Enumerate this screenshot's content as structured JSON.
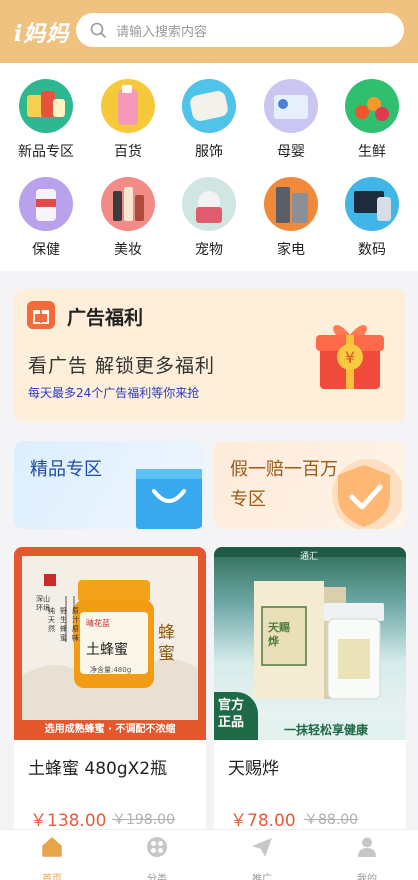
{
  "header": {
    "logo": "i妈妈",
    "search_placeholder": "请输入搜索内容"
  },
  "categories": [
    {
      "label": "新品专区",
      "icon": "new-products-icon"
    },
    {
      "label": "百货",
      "icon": "general-goods-icon"
    },
    {
      "label": "服饰",
      "icon": "clothing-icon"
    },
    {
      "label": "母婴",
      "icon": "mother-baby-icon"
    },
    {
      "label": "生鲜",
      "icon": "fresh-food-icon"
    },
    {
      "label": "保健",
      "icon": "health-icon"
    },
    {
      "label": "美妆",
      "icon": "beauty-icon"
    },
    {
      "label": "宠物",
      "icon": "pet-icon"
    },
    {
      "label": "家电",
      "icon": "appliance-icon"
    },
    {
      "label": "数码",
      "icon": "digital-icon"
    }
  ],
  "ad_banner": {
    "title": "广告福利",
    "headline": "看广告  解锁更多福利",
    "subline": "每天最多24个广告福利等你来抢"
  },
  "promos": {
    "left": "精品专区",
    "right_line1": "假一赔一百万",
    "right_line2": "专区"
  },
  "products": [
    {
      "title": "土蜂蜜 480gX2瓶",
      "price": "￥138.00",
      "old_price": "￥198.00",
      "image_caption": "选用成熟蜂蜜 · 不调配不浓缩",
      "image_label": "土蜂蜜",
      "image_side": "蜂蜜",
      "jar_brand": "晴花蓝",
      "jar_weight": "净含量:480g",
      "image_notes": [
        "深山环境",
        "纯天然",
        "野生蜂蜜",
        "原汁原味"
      ]
    },
    {
      "title": "天赐烨",
      "price": "￥78.00",
      "old_price": "￥88.00",
      "image_caption": "一抹轻松享健康",
      "badge_line1": "官方",
      "badge_line2": "正品",
      "box_label": "天赐烨",
      "top_mark": "通汇"
    }
  ],
  "tabbar": [
    {
      "label": "首页",
      "active": true,
      "icon": "home-icon"
    },
    {
      "label": "分类",
      "active": false,
      "icon": "category-icon"
    },
    {
      "label": "推广",
      "active": false,
      "icon": "send-icon"
    },
    {
      "label": "我的",
      "active": false,
      "icon": "user-icon"
    }
  ],
  "colors": {
    "header": "#f0c27f",
    "price": "#e85a3d",
    "active_tab": "#e8a44a",
    "ad_sub": "#2b3bbd"
  }
}
